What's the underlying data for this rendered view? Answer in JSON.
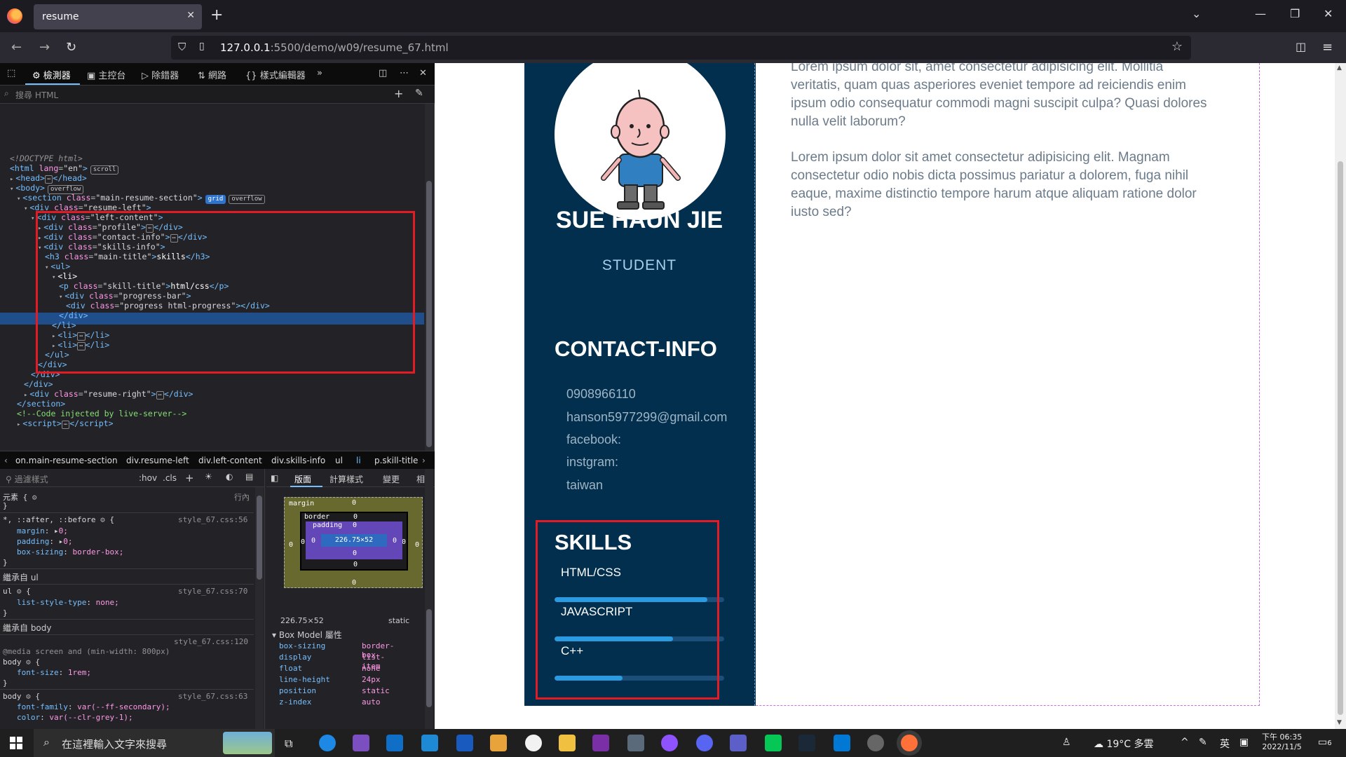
{
  "browser": {
    "tab_title": "resume",
    "url_host": "127.0.0.1",
    "url_rest": ":5500/demo/w09/resume_67.html"
  },
  "devtools": {
    "tabs": [
      "檢測器",
      "主控台",
      "除錯器",
      "網路",
      "樣式編輯器"
    ],
    "search_placeholder": "搜尋 HTML",
    "markup": [
      {
        "html": "<span class=\"cm\">&lt;!DOCTYPE html&gt;</span>"
      },
      {
        "html": "<span class=\"tag\">&lt;html</span> <span class=\"an\">lang</span>=<span class=\"av\">\"en\"</span><span class=\"tag\">&gt;</span><span class=\"badge\">scroll</span>"
      },
      {
        "html": "<span class=\"tag\">&lt;head&gt;</span><span class=\"dots\">⋯</span><span class=\"tag\">&lt;/head&gt;</span>"
      },
      {
        "html": "<span class=\"tag\">&lt;body&gt;</span><span class=\"badge\">overflow</span>"
      },
      {
        "html": "<span class=\"tag\">&lt;section</span> <span class=\"an\">class</span>=<span class=\"av\">\"main-resume-section\"</span><span class=\"tag\">&gt;</span><span class=\"badge grid\">grid</span><span class=\"badge\">overflow</span>"
      },
      {
        "html": "<span class=\"tag\">&lt;div</span> <span class=\"an\">class</span>=<span class=\"av\">\"resume-left\"</span><span class=\"tag\">&gt;</span>"
      },
      {
        "html": "<span class=\"tag\">&lt;div</span> <span class=\"an\">class</span>=<span class=\"av\">\"left-content\"</span><span class=\"tag\">&gt;</span>"
      },
      {
        "html": "<span class=\"tag\">&lt;div</span> <span class=\"an\">class</span>=<span class=\"av\">\"profile\"</span><span class=\"tag\">&gt;</span><span class=\"dots\">⋯</span><span class=\"tag\">&lt;/div&gt;</span>"
      },
      {
        "html": "<span class=\"tag\">&lt;div</span> <span class=\"an\">class</span>=<span class=\"av\">\"contact-info\"</span><span class=\"tag\">&gt;</span><span class=\"dots\">⋯</span><span class=\"tag\">&lt;/div&gt;</span>"
      },
      {
        "html": "<span class=\"tag\">&lt;div</span> <span class=\"an\">class</span>=<span class=\"av\">\"skills-info\"</span><span class=\"tag\">&gt;</span>"
      },
      {
        "html": "<span class=\"tag\">&lt;h3</span> <span class=\"an\">class</span>=<span class=\"av\">\"main-title\"</span><span class=\"tag\">&gt;</span><span class=\"txt\">skills</span><span class=\"tag\">&lt;/h3&gt;</span>"
      },
      {
        "html": "<span class=\"tag\">&lt;ul&gt;</span>"
      },
      {
        "html": "<span class=\"tag\">&lt;li&gt;</span>"
      },
      {
        "html": "<span class=\"tag\">&lt;p</span> <span class=\"an\">class</span>=<span class=\"av\">\"skill-title\"</span><span class=\"tag\">&gt;</span><span class=\"txt\">html/css</span><span class=\"tag\">&lt;/p&gt;</span>"
      },
      {
        "html": "<span class=\"tag\">&lt;div</span> <span class=\"an\">class</span>=<span class=\"av\">\"progress-bar\"</span><span class=\"tag\">&gt;</span>"
      },
      {
        "html": "<span class=\"tag\">&lt;div</span> <span class=\"an\">class</span>=<span class=\"av\">\"progress html-progress\"</span><span class=\"tag\">&gt;&lt;/div&gt;</span>"
      },
      {
        "html": "<span class=\"tag\">&lt;/div&gt;</span>"
      },
      {
        "html": "<span class=\"tag\">&lt;/li&gt;</span>"
      },
      {
        "html": "<span class=\"tag\">&lt;li&gt;</span><span class=\"dots\">⋯</span><span class=\"tag\">&lt;/li&gt;</span>"
      },
      {
        "html": "<span class=\"tag\">&lt;li&gt;</span><span class=\"dots\">⋯</span><span class=\"tag\">&lt;/li&gt;</span>"
      },
      {
        "html": "<span class=\"tag\">&lt;/ul&gt;</span>"
      },
      {
        "html": "<span class=\"tag\">&lt;/div&gt;</span>"
      },
      {
        "html": "<span class=\"tag\">&lt;/div&gt;</span>"
      },
      {
        "html": "<span class=\"tag\">&lt;/div&gt;</span>"
      },
      {
        "html": "<span class=\"tag\">&lt;div</span> <span class=\"an\">class</span>=<span class=\"av\">\"resume-right\"</span><span class=\"tag\">&gt;</span><span class=\"dots\">⋯</span><span class=\"tag\">&lt;/div&gt;</span>"
      },
      {
        "html": "<span class=\"tag\">&lt;/section&gt;</span>"
      },
      {
        "html": "<span class=\"cm\" style=\"color:#86de74;font-style:normal\">&lt;!--Code injected by live-server--&gt;</span>"
      },
      {
        "html": "<span class=\"tag\">&lt;script&gt;</span><span class=\"dots\">⋯</span><span class=\"tag\">&lt;/script&gt;</span>"
      }
    ],
    "breadcrumbs": [
      "on.main-resume-section",
      "div.resume-left",
      "div.left-content",
      "div.skills-info",
      "ul",
      "li",
      "p.skill-title"
    ],
    "rules": {
      "filter_placeholder": "過濾樣式",
      "hov": ":hov",
      "cls": ".cls",
      "element_label": "元素 {",
      "inline_label": "行內",
      "universal_selector": "*, ::after, ::before",
      "src_56": "style_67.css:56",
      "margin_prop": "margin",
      "margin_val": "0;",
      "padding_prop": "padding",
      "padding_val": "0;",
      "boxsizing_prop": "box-sizing",
      "boxsizing_val": "border-box;",
      "inherit_ul": "繼承自 ul",
      "ul_selector": "ul",
      "src_70": "style_67.css:70",
      "lst_prop": "list-style-type",
      "lst_val": "none;",
      "inherit_body": "繼承自 body",
      "src_120": "style_67.css:120",
      "media": "@media screen and (min-width: 800px)",
      "body_selector": "body",
      "fs_prop": "font-size",
      "fs_val": "1rem;",
      "src_63": "style_67.css:63",
      "ff_prop": "font-family",
      "ff_val": "var(--ff-secondary);",
      "color_prop": "color",
      "color_val": "var(--clr-grey-1);"
    },
    "layout": {
      "tabs": [
        "版面",
        "計算樣式",
        "變更",
        "相"
      ],
      "margin_label": "margin",
      "border_label": "border",
      "padding_label": "padding",
      "content_size": "226.75×52",
      "zero": "0",
      "size_text": "226.75×52",
      "position_text": "static",
      "box_model_header": "Box Model 屬性",
      "props": [
        {
          "k": "box-sizing",
          "v": "border-box"
        },
        {
          "k": "display",
          "v": "list-item"
        },
        {
          "k": "float",
          "v": "none"
        },
        {
          "k": "line-height",
          "v": "24px"
        },
        {
          "k": "position",
          "v": "static"
        },
        {
          "k": "z-index",
          "v": "auto"
        }
      ]
    }
  },
  "page": {
    "name": "SUE HAUN JIE",
    "job": "STUDENT",
    "contact_title": "CONTACT-INFO",
    "contacts": [
      "0908966110",
      "hanson5977299@gmail.com",
      "facebook:",
      "instgram:",
      "taiwan"
    ],
    "skills_title": "SKILLS",
    "skills": [
      {
        "name": "HTML/CSS",
        "level": 0.9
      },
      {
        "name": "JAVASCRIPT",
        "level": 0.7
      },
      {
        "name": "C++",
        "level": 0.4
      }
    ],
    "paragraphs": [
      "Lorem ipsum dolor sit, amet consectetur adipisicing elit. Mollitia veritatis, quam quas asperiores eveniet tempore ad reiciendis enim ipsum odio consequatur commodi magni suscipit culpa? Quasi dolores nulla velit laborum?",
      "Lorem ipsum dolor sit amet consectetur adipisicing elit. Magnam consectetur odio nobis dicta possimus pariatur a dolorem, fuga nihil eaque, maxime distinctio tempore harum atque aliquam ratione dolor iusto sed?"
    ]
  },
  "taskbar": {
    "search_placeholder": "在這裡輸入文字來搜尋",
    "weather": "19°C 多雲",
    "ime": "英",
    "time": "下午 06:35",
    "date": "2022/11/5",
    "notif_count": "6"
  }
}
